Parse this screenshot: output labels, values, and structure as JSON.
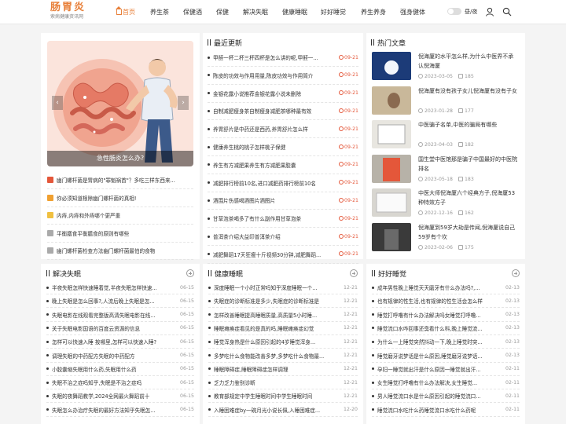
{
  "header": {
    "logo_title": "肠胃炎",
    "logo_subtitle": "索病健康资讯网",
    "theme_label": "昼/夜",
    "nav": [
      {
        "label": "首页",
        "active": true
      },
      {
        "label": "养生茶"
      },
      {
        "label": "保健酒"
      },
      {
        "label": "保健"
      },
      {
        "label": "解决失眠"
      },
      {
        "label": "健康睡眠"
      },
      {
        "label": "好好睡觉"
      },
      {
        "label": "养生养身"
      },
      {
        "label": "强身健体"
      }
    ]
  },
  "hero": {
    "caption": "急性肠炎怎么办?",
    "prev": "‹",
    "next": "›"
  },
  "hero_list": [
    {
      "text": "幽门螺杆菌是胃病的\"罪魁祸首\"？多吃三样东西来...",
      "icon_color": "#e4573a"
    },
    {
      "text": "你必须知道根除幽门螺杆菌的真相!",
      "icon_color": "#f0a030"
    },
    {
      "text": "内痔,内痔和外痔哪个更严重",
      "icon_color": "#f0c040"
    },
    {
      "text": "平衡膳食平衡膳食的原则有哪些",
      "icon_color": "#aaaaaa"
    },
    {
      "text": "幽门螺杆菌检查方法幽门螺杆菌最怕的食物",
      "icon_color": "#aaaaaa"
    }
  ],
  "latest": {
    "title": "最近更新",
    "items": [
      {
        "text": "甲醛一杯二杯三杯四杯是怎么讲的呢,甲醛一...",
        "date": "09-21"
      },
      {
        "text": "陈皮的功效与作用用量,陈皮功效与作用简介",
        "date": "09-21"
      },
      {
        "text": "金银花露小说推荐金银花露小说未删除",
        "date": "09-21"
      },
      {
        "text": "自制减肥瘦身茶自制瘦身减肥茶哪种最有效",
        "date": "09-21"
      },
      {
        "text": "养胃舒片是中药还是西药,养胃舒片怎么样",
        "date": "09-21"
      },
      {
        "text": "健康养生桃的桃子怎样桃子保健",
        "date": "09-21"
      },
      {
        "text": "养生有方减肥果养生有方减肥果胶囊",
        "date": "09-21"
      },
      {
        "text": "减肥排行榜前10名,进口减肥药排行榜前10名",
        "date": "09-21"
      },
      {
        "text": "酒围片伤感喝酒图片酒图片",
        "date": "09-21"
      },
      {
        "text": "甘草泡茶喝多了有什么副作用甘草泡茶",
        "date": "09-21"
      },
      {
        "text": "普洱茶介绍大益印普洱茶介绍",
        "date": "09-21"
      },
      {
        "text": "减肥舞蹈17天狂瘦十斤视频30分钟,减肥舞蹈...",
        "date": "09-21"
      }
    ]
  },
  "hot": {
    "title": "热门文章",
    "items": [
      {
        "title": "倪海厦的水平怎么样,为什么中医界不承认倪海厦",
        "date": "2023-03-05",
        "count": "185"
      },
      {
        "title": "倪海厦有没有孩子女儿倪海厦有没有子女",
        "date": "2023-01-28",
        "count": "177"
      },
      {
        "title": "中医骗子名单,中医的骗局有哪些",
        "date": "2023-04-03",
        "count": "182"
      },
      {
        "title": "国生堂中医馆那是骗子中国最好的中医院排名",
        "date": "2023-05-18",
        "count": "183"
      },
      {
        "title": "中医大师倪海厦六个经典方子,倪海厦53种特效方子",
        "date": "2022-12-16",
        "count": "162"
      },
      {
        "title": "倪海厦到59岁大劫是传闻,倪海厦说自己59岁有个坎",
        "date": "2023-02-06",
        "count": "175"
      }
    ]
  },
  "insomnia": {
    "title": "解决失眠",
    "items": [
      {
        "text": "半夜失眠怎样快速睡着觉,半夜失眠怎样快速...",
        "date": "06-15"
      },
      {
        "text": "晚上失眠是怎么回事?,人流后晚上失眠是怎...",
        "date": "06-15"
      },
      {
        "text": "失眠电影在线观看完整版高清失眠电影在线...",
        "date": "06-15"
      },
      {
        "text": "关于失眠电影国语的百度云资源的信息",
        "date": "06-15"
      },
      {
        "text": "怎样可以快速入睡 按哪里,怎样可以快速入睡?",
        "date": "06-15"
      },
      {
        "text": "调理失眠的中药配方失眠的中药配方",
        "date": "06-15"
      },
      {
        "text": "小胶囊缩失眠用什么药,失眠用什么药",
        "date": "06-15"
      },
      {
        "text": "失眠不治之症吗知乎,失眠是不治之症吗",
        "date": "06-15"
      },
      {
        "text": "失眠的夜舞蹈教学,2024全网最火舞蹈前十",
        "date": "06-15"
      },
      {
        "text": "失眠怎么办治疗失眠的最好方法知乎失眠怎...",
        "date": "06-15"
      }
    ]
  },
  "healthy_sleep": {
    "title": "健康睡眠",
    "items": [
      {
        "text": "深度睡眠一个小时正常吗知乎深度睡眠一个...",
        "date": "12-21"
      },
      {
        "text": "失眠症的诊断标准是多少,失眠症的诊断标准是",
        "date": "12-21"
      },
      {
        "text": "怎样改善睡眠提高睡眠质量,高质量5小时睡...",
        "date": "12-21"
      },
      {
        "text": "睡眠瘫痪症看见的是真的吗,睡眠瘫痪症幻觉",
        "date": "12-21"
      },
      {
        "text": "睡觉浑身热是什么原因引起的4岁睡觉浑身...",
        "date": "12-21"
      },
      {
        "text": "多梦吃什么食物能改善多梦,多梦吃什么食物最...",
        "date": "12-21"
      },
      {
        "text": "睡眠障碍症,睡眠障碍症怎样调理",
        "date": "12-21"
      },
      {
        "text": "乏力乏力鉴别诊断",
        "date": "12-21"
      },
      {
        "text": "教育部规定中学生睡眠时间中学生睡眠时间",
        "date": "12-21"
      },
      {
        "text": "入睡困难症by一碗月光小说长佩,入睡困难症...",
        "date": "12-20"
      }
    ]
  },
  "good_sleep": {
    "title": "好好睡觉",
    "items": [
      {
        "text": "成年男性晚上睡觉天天磨牙有什么办法吗?,...",
        "date": "02-13"
      },
      {
        "text": "也有规律的性生活,也有规律的性生活会怎么样",
        "date": "02-13"
      },
      {
        "text": "睡觉打呼噜有什么办法解决吗女睡觉打呼噜...",
        "date": "02-13"
      },
      {
        "text": "睡觉流口水咋回事还臭看什么科,晚上睡觉流...",
        "date": "02-13"
      },
      {
        "text": "为什么一上睡觉突然抖动一下,晚上睡觉时突...",
        "date": "02-13"
      },
      {
        "text": "睡觉磨牙说梦话是什么原因,睡觉磨牙说梦话...",
        "date": "02-13"
      },
      {
        "text": "孕妇一睡觉就出汗是什么原因一睡觉就出汗...",
        "date": "02-11"
      },
      {
        "text": "女生睡觉打呼噜有什么办法解决,女生睡觉...",
        "date": "02-11"
      },
      {
        "text": "男人睡觉流口水是什么原因引起的睡觉流口...",
        "date": "02-11"
      },
      {
        "text": "睡觉流口水吃什么药睡觉流口水吃什么药呢",
        "date": "02-11"
      }
    ]
  },
  "colors": {
    "accent": "#e8803a",
    "date_red": "#e4573a"
  }
}
